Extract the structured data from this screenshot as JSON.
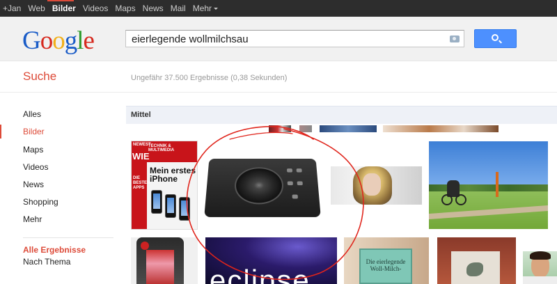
{
  "topnav": {
    "items": [
      "+Jan",
      "Web",
      "Bilder",
      "Videos",
      "Maps",
      "News",
      "Mail",
      "Mehr"
    ],
    "active_index": 2
  },
  "logo": {
    "letters": [
      "G",
      "o",
      "o",
      "g",
      "l",
      "e"
    ]
  },
  "search": {
    "query": "eierlegende wollmilchsau"
  },
  "subheader": {
    "section_title": "Suche",
    "stats": "Ungefähr 37.500 Ergebnisse (0,38 Sekunden)"
  },
  "leftnav": {
    "items": [
      "Alles",
      "Bilder",
      "Maps",
      "Videos",
      "News",
      "Shopping",
      "Mehr"
    ],
    "active_index": 1,
    "all_results": "Alle Ergebnisse",
    "by_topic": "Nach Thema"
  },
  "results": {
    "size_filter": "Mittel",
    "magazine": {
      "top_left": "NEWEST",
      "brand": "TECHNIK & MULTIMEDIA",
      "big": "WIE",
      "headline": "Mein erstes iPhone",
      "side": "DIE BESTEN APPS"
    },
    "eclipse_text": "eclipse",
    "book_text": "Die eierlegende Woll-Milch-"
  },
  "colors": {
    "accent_red": "#dd4b39",
    "topbar": "#2d2d2d",
    "search_button": "#4d90fe",
    "annotation": "#e0241b"
  }
}
